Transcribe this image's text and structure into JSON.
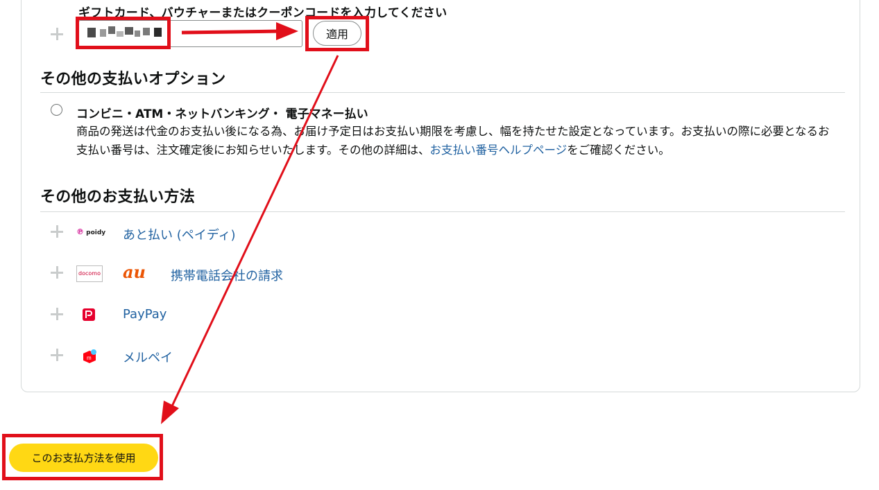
{
  "gift": {
    "label": "ギフトカード、バウチャーまたはクーポンコードを入力してください",
    "apply_label": "適用"
  },
  "other_options": {
    "title": "その他の支払いオプション",
    "option_title": "コンビニ・ATM・ネットバンキング・ 電子マネー払い",
    "desc_before": "商品の発送は代金のお支払い後になる為、お届け予定日はお支払い期限を考慮し、幅を持たせた設定となっています。お支払いの際に必要となるお支払い番号は、注文確定後にお知らせいたします。その他の詳細は、",
    "desc_link": "お支払い番号ヘルプページ",
    "desc_after": "をご確認ください。"
  },
  "other_methods": {
    "title": "その他のお支払い方法",
    "items": [
      {
        "label": "あと払い (ペイディ)",
        "logo": "poidy"
      },
      {
        "label": "携帯電話会社の請求",
        "logo_docomo": "docomo",
        "logo_au": "au"
      },
      {
        "label": "PayPay",
        "logo": "paypay-icon"
      },
      {
        "label": "メルペイ",
        "logo": "merpay-icon"
      }
    ]
  },
  "use_button_label": "このお支払方法を使用",
  "annotation_color": "#e10f1a",
  "accent_yellow": "#ffd814",
  "link_color": "#2162a1"
}
